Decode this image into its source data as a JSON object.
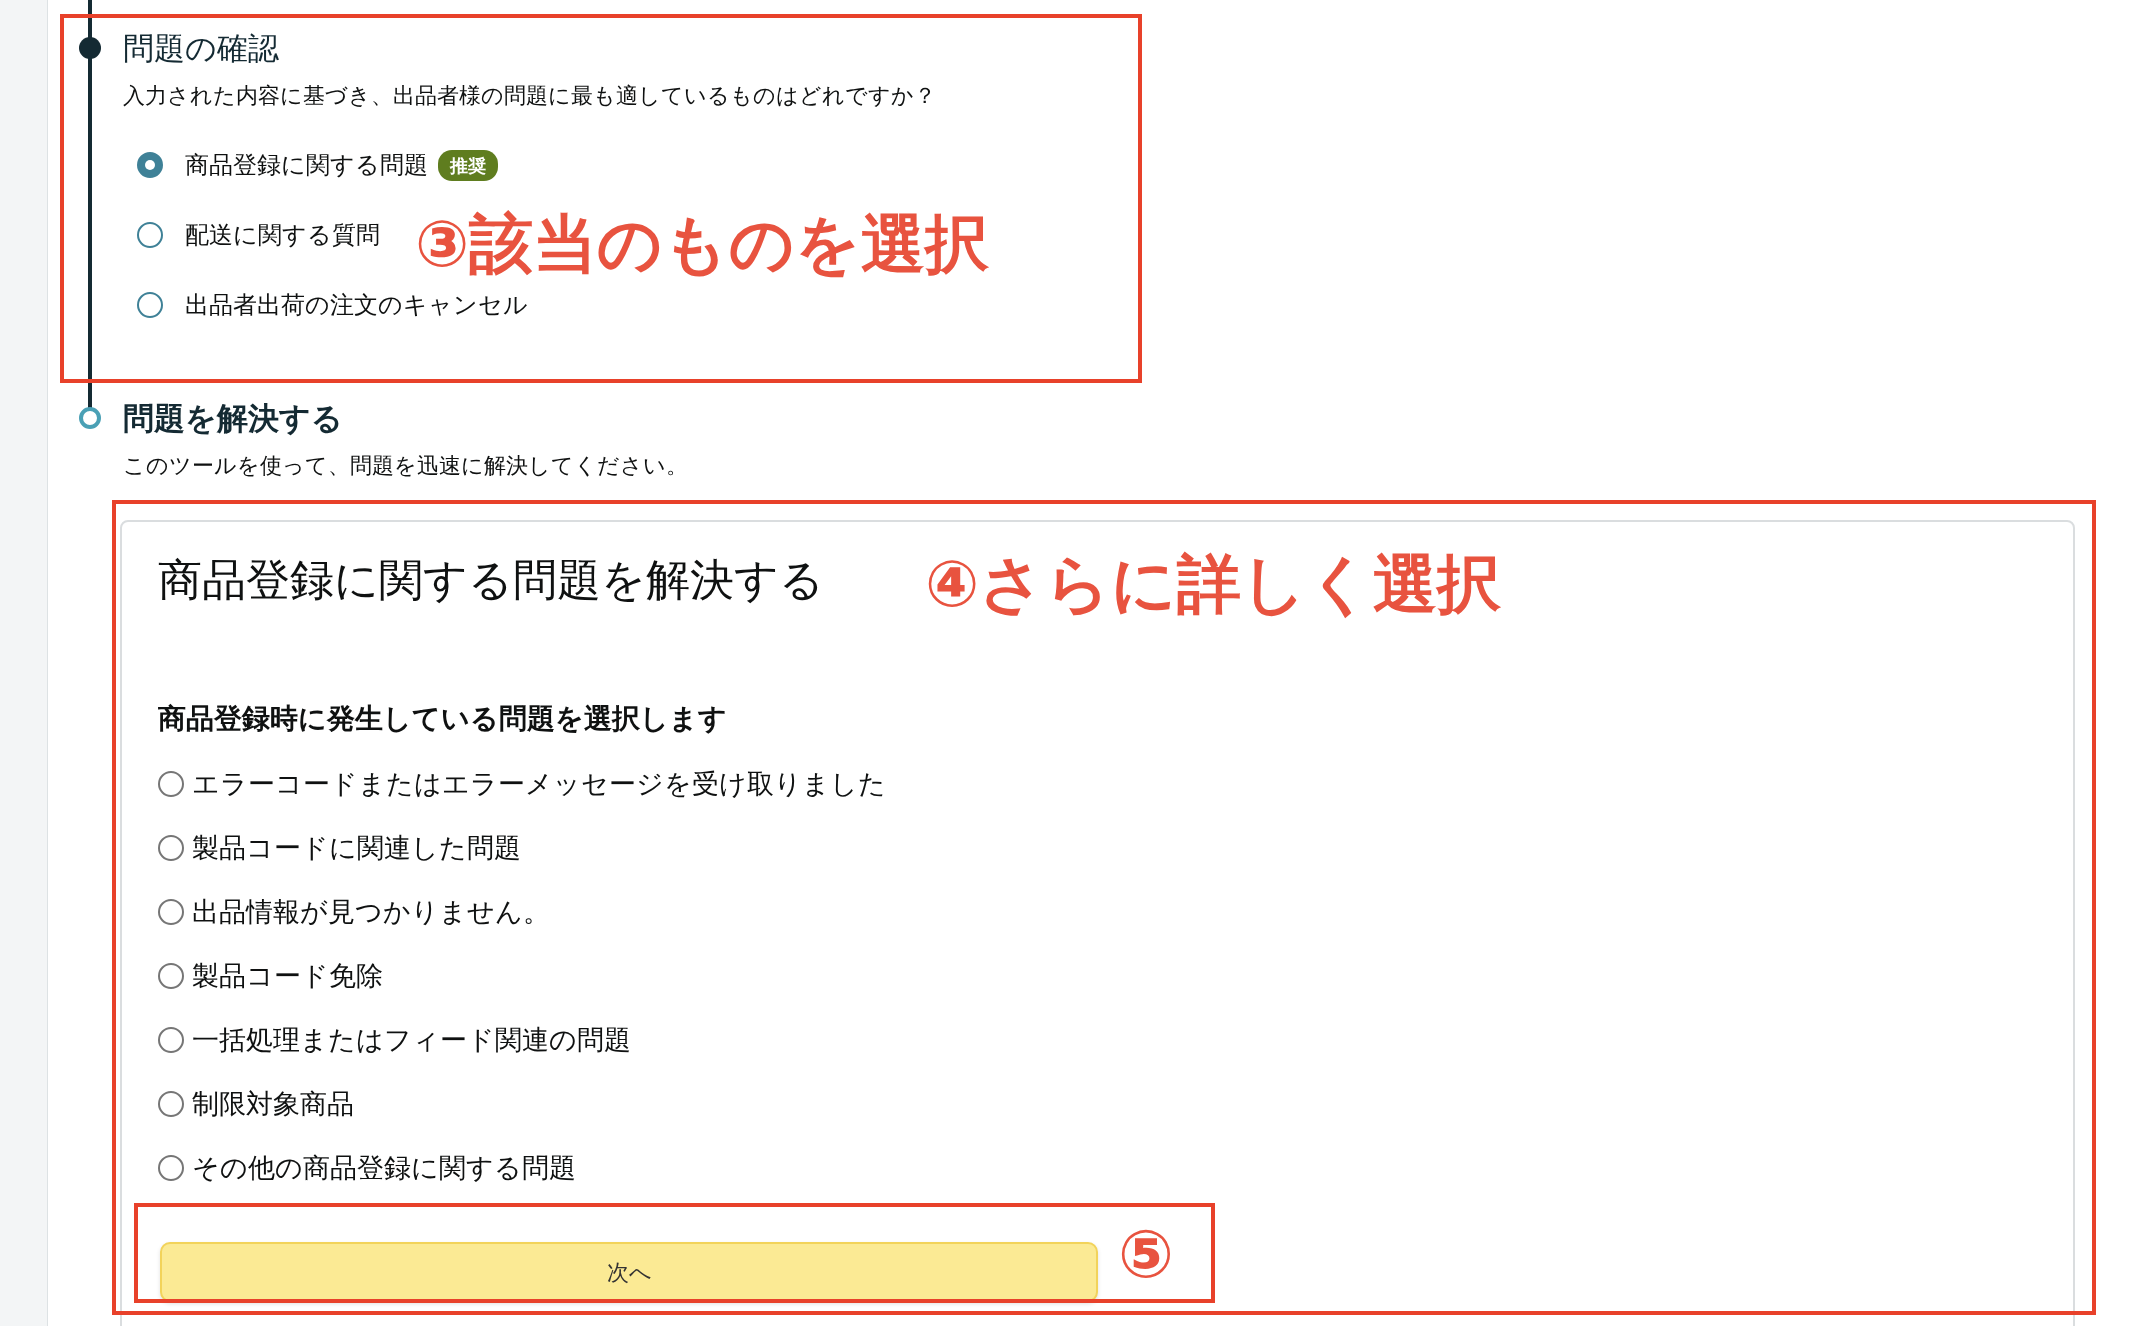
{
  "steps": [
    {
      "title": "問題の確認",
      "completed": true,
      "description": "入力された内容に基づき、出品者様の問題に最も適しているものはどれですか？",
      "options": [
        {
          "label": "商品登録に関する問題",
          "badge": "推奨",
          "selected": true
        },
        {
          "label": "配送に関する質問",
          "selected": false
        },
        {
          "label": "出品者出荷の注文のキャンセル",
          "selected": false
        }
      ]
    },
    {
      "title": "問題を解決する",
      "completed": false,
      "description": "このツールを使って、問題を迅速に解決してください。"
    }
  ],
  "panel": {
    "title": "商品登録に関する問題を解決する",
    "question": "商品登録時に発生している問題を選択します",
    "options": [
      {
        "label": "エラーコードまたはエラーメッセージを受け取りました",
        "selected": false
      },
      {
        "label": "製品コードに関連した問題",
        "selected": false
      },
      {
        "label": "出品情報が見つかりません。",
        "selected": false
      },
      {
        "label": "製品コード免除",
        "selected": false
      },
      {
        "label": "一括処理またはフィード関連の問題",
        "selected": false
      },
      {
        "label": "制限対象商品",
        "selected": false
      },
      {
        "label": "その他の商品登録に関する問題",
        "selected": false
      }
    ],
    "button": "次へ"
  },
  "annotations": [
    {
      "text": "③該当のものを選択"
    },
    {
      "text": "④さらに詳しく選択"
    },
    {
      "text": "⑤"
    }
  ]
}
